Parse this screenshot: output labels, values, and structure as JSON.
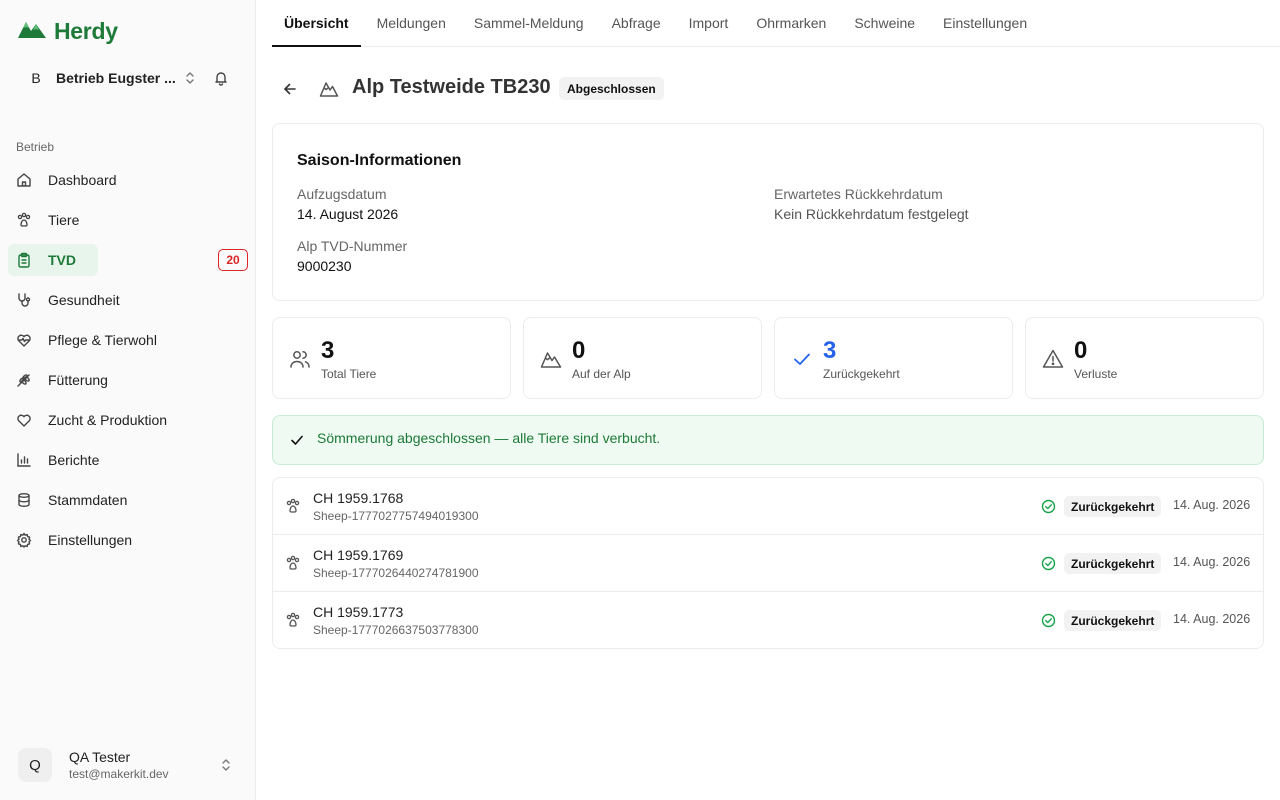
{
  "app": {
    "name": "Herdy"
  },
  "tenant": {
    "avatar": "B",
    "name": "Betrieb Eugster ..."
  },
  "sidebar": {
    "section_label": "Betrieb",
    "items": [
      {
        "label": "Dashboard",
        "icon": "home-icon"
      },
      {
        "label": "Tiere",
        "icon": "paw-icon"
      },
      {
        "label": "TVD",
        "icon": "clipboard-icon",
        "badge": "20",
        "active": true
      },
      {
        "label": "Gesundheit",
        "icon": "stethoscope-icon"
      },
      {
        "label": "Pflege & Tierwohl",
        "icon": "heart-pulse-icon"
      },
      {
        "label": "Fütterung",
        "icon": "wheat-icon"
      },
      {
        "label": "Zucht & Produktion",
        "icon": "heart-icon"
      },
      {
        "label": "Berichte",
        "icon": "bar-chart-icon"
      },
      {
        "label": "Stammdaten",
        "icon": "database-icon"
      },
      {
        "label": "Einstellungen",
        "icon": "gear-icon"
      }
    ]
  },
  "user": {
    "avatar": "Q",
    "name": "QA Tester",
    "email": "test@makerkit.dev"
  },
  "tabs": [
    {
      "label": "Übersicht",
      "active": true
    },
    {
      "label": "Meldungen"
    },
    {
      "label": "Sammel-Meldung"
    },
    {
      "label": "Abfrage"
    },
    {
      "label": "Import"
    },
    {
      "label": "Ohrmarken"
    },
    {
      "label": "Schweine"
    },
    {
      "label": "Einstellungen"
    }
  ],
  "header": {
    "title": "Alp Testweide TB230",
    "status": "Abgeschlossen"
  },
  "season": {
    "title": "Saison-Informationen",
    "ascent_label": "Aufzugsdatum",
    "ascent_value": "14. August 2026",
    "return_label": "Erwartetes Rückkehrdatum",
    "return_value": "Kein Rückkehrdatum festgelegt",
    "tvd_label": "Alp TVD-Nummer",
    "tvd_value": "9000230"
  },
  "stats": [
    {
      "value": "3",
      "label": "Total Tiere",
      "icon": "users-icon"
    },
    {
      "value": "0",
      "label": "Auf der Alp",
      "icon": "mountain-icon"
    },
    {
      "value": "3",
      "label": "Zurückgekehrt",
      "icon": "check-icon",
      "accent": "#2563eb"
    },
    {
      "value": "0",
      "label": "Verluste",
      "icon": "warning-icon"
    }
  ],
  "alert": {
    "text": "Sömmerung abgeschlossen — alle Tiere sind verbucht."
  },
  "animals": [
    {
      "id": "CH 1959.1768",
      "sub": "Sheep-1777027757494019300",
      "status": "Zurückgekehrt",
      "date": "14. Aug. 2026"
    },
    {
      "id": "CH 1959.1769",
      "sub": "Sheep-1777026440274781900",
      "status": "Zurückgekehrt",
      "date": "14. Aug. 2026"
    },
    {
      "id": "CH 1959.1773",
      "sub": "Sheep-1777026637503778300",
      "status": "Zurückgekehrt",
      "date": "14. Aug. 2026"
    }
  ],
  "colors": {
    "brand": "#1e7a38",
    "danger": "#dc2626",
    "accent_blue": "#2563eb",
    "success_bg": "#eefaf2"
  }
}
